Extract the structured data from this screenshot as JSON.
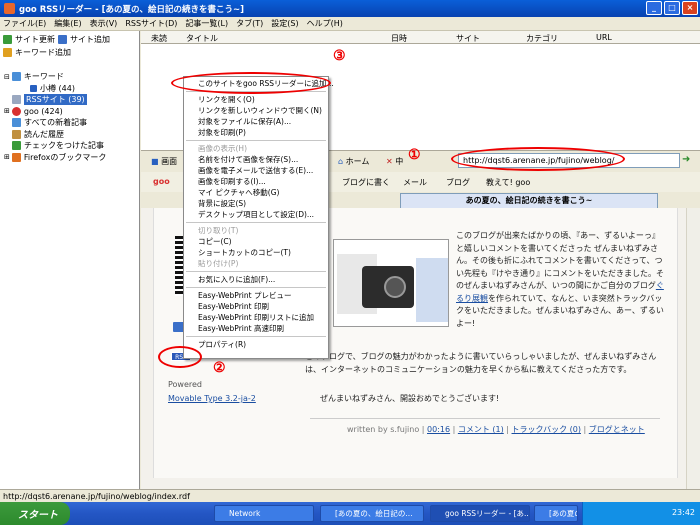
{
  "window": {
    "title": "goo RSSリーダー - [あの夏の、絵日記の続きを書こう~]"
  },
  "menu": [
    "ファイル(E)",
    "編集(E)",
    "表示(V)",
    "RSSサイト(D)",
    "記事一覧(L)",
    "タブ(T)",
    "設定(S)",
    "ヘルプ(H)"
  ],
  "left": {
    "buttons": [
      "サイト更新",
      "サイト追加",
      "キーワード追加"
    ],
    "tree": [
      {
        "label": "キーワード"
      },
      {
        "label": "小樽 (44)"
      },
      {
        "label": "RSSサイト (39)"
      },
      {
        "label": "goo (424)"
      },
      {
        "label": "すべての新着記事"
      },
      {
        "label": "読んだ履歴"
      },
      {
        "label": "チェックをつけた記事"
      },
      {
        "label": "Firefoxのブックマーク"
      }
    ]
  },
  "list": {
    "columns": [
      "未読",
      "タイトル",
      "日時",
      "サイト",
      "カテゴリ",
      "URL"
    ]
  },
  "toolbar": {
    "items": [
      "画面",
      "ホーム",
      "中"
    ],
    "address": "http://dqst6.arenane.jp/fujino/weblog/"
  },
  "toolbar2": {
    "items": [
      "goo",
      "ブログに書く",
      "メール",
      "ブログ",
      "教えて! goo"
    ]
  },
  "tab": {
    "label": "あの夏の、絵日記の続きを書こう~"
  },
  "context_menu": {
    "groups": [
      [
        "このサイトをgoo RSSリーダーに追加..."
      ],
      [
        "リンクを開く(O)",
        "リンクを新しいウィンドウで開く(N)",
        "対象をファイルに保存(A)...",
        "対象を印刷(P)"
      ],
      [
        "画像の表示(H)",
        "名前を付けて画像を保存(S)...",
        "画像を電子メールで送信する(E)...",
        "画像を印刷する(I)...",
        "マイ ピクチャへ移動(G)",
        "背景に設定(S)",
        "デスクトップ項目として設定(D)..."
      ],
      [
        "切り取り(T)",
        "コピー(C)",
        "ショートカットのコピー(T)",
        "貼り付け(P)"
      ],
      [
        "お気に入りに追加(F)..."
      ],
      [
        "Easy-WebPrint プレビュー",
        "Easy-WebPrint 印刷",
        "Easy-WebPrint 印刷リストに追加",
        "Easy-WebPrint 高速印刷"
      ],
      [
        "プロパティ(R)"
      ]
    ],
    "disabled": [
      "画像の表示(H)",
      "切り取り(T)",
      "貼り付け(P)"
    ]
  },
  "content": {
    "paragraph1": "このブログが出来たばかりの頃、『あー、ずるいよーっ』と嬉しいコメントを書いてくださった ぜんまいねずみさん。その後も折にふれてコメントを書いてくださって、つい先程も『けやき通り』にコメントをいただきました。そのぜんまいねずみさんが、いつの間にかご自分のブログ",
    "link1": "ぐるり展観",
    "paragraph1b": "を作られていて、なんと、いま突然トラックバックをいただきました。ぜんまいねずみさん、あー、ずるいよー!",
    "paragraph2": "このブログで、ブログの魅力がわかったように書いていらっしゃいましたが、ぜんまいねずみさんは、インターネットのコミュニケーションの魅力を早くから私に教えてくださった方です。",
    "paragraph3": "ぜんまいねずみさん、開設おめでとうございます!",
    "footer": "written by s.fujino",
    "footer_time": "00:16",
    "footer_comment": "コメント (1)",
    "footer_tb": "トラックバック (0)",
    "footer_cat": "ブログとネット",
    "powered": "Powered",
    "powered_link": "Movable Type 3.2-ja-2",
    "rss_badge": "RSS"
  },
  "annotations": [
    "①",
    "②",
    "③"
  ],
  "status": "http://dqst6.arenane.jp/fujino/weblog/index.rdf",
  "taskbar": {
    "start": "スタート",
    "items": [
      "Network",
      "[あの夏の、絵日記の...",
      "goo RSSリーダー - [あ...",
      "[あの夏の、絵日記の..."
    ],
    "clock": "23:42"
  }
}
